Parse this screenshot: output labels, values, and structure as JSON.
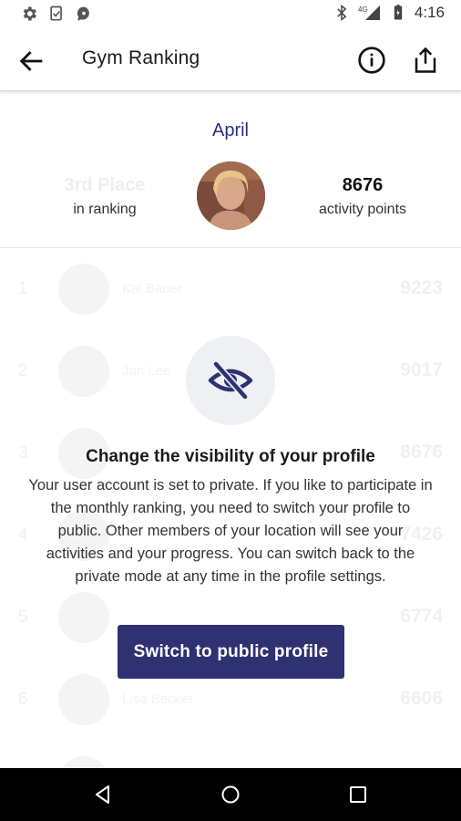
{
  "status_bar": {
    "left_icons": [
      "gear-icon",
      "task-check-icon",
      "message-bubble-icon"
    ],
    "right_icons": [
      "bluetooth-icon",
      "signal-4g-icon",
      "battery-icon"
    ],
    "network": "4G",
    "time": "4:16"
  },
  "app_bar": {
    "title": "Gym Ranking",
    "icons": [
      "back-arrow-icon",
      "info-icon",
      "share-icon"
    ]
  },
  "ranking": {
    "month": "April",
    "place": "3rd Place",
    "place_caption": "in ranking",
    "points": "8676",
    "points_caption": "activity points"
  },
  "list": {
    "rows": [
      {
        "rank": "1",
        "name": "Kai Bauer",
        "points": "9223"
      },
      {
        "rank": "2",
        "name": "Jan Lee",
        "points": "9017"
      },
      {
        "rank": "3",
        "name": "",
        "points": "8676"
      },
      {
        "rank": "4",
        "name": "",
        "points": "7426"
      },
      {
        "rank": "5",
        "name": "",
        "points": "6774"
      },
      {
        "rank": "6",
        "name": "Lisa Becker",
        "points": "6606"
      }
    ]
  },
  "dialog": {
    "icon": "eye-slash-icon",
    "title": "Change the visibility of your profile",
    "body": "Your user account is set to private. If you like to participate in the monthly ranking, you need to switch your profile to public. Other members of your location will see your activities and your progress. You can switch back to the private mode at any time in the profile settings.",
    "button_label": "Switch to public profile"
  },
  "colors": {
    "accent": "#2e3272",
    "month_text": "#2b2f7a",
    "eye_circle_bg": "#eef0f4"
  },
  "nav_bar": {
    "buttons": [
      "back-triangle-icon",
      "home-circle-icon",
      "recents-square-icon"
    ]
  }
}
